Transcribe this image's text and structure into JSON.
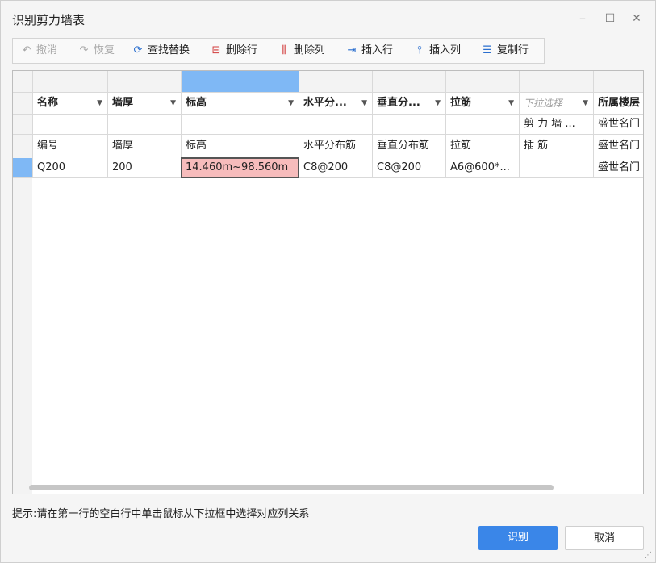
{
  "window": {
    "title": "识别剪力墙表",
    "controls": {
      "minimize": "–",
      "maximize": "☐",
      "close": "✕"
    }
  },
  "toolbar": {
    "undo": {
      "label": "撤消",
      "icon": "undo-icon",
      "glyph": "↶",
      "enabled": false
    },
    "redo": {
      "label": "恢复",
      "icon": "redo-icon",
      "glyph": "↷",
      "enabled": false
    },
    "find_replace": {
      "label": "查找替换",
      "icon": "find-replace-icon",
      "glyph": "⟳",
      "enabled": true
    },
    "delete_row": {
      "label": "删除行",
      "icon": "delete-row-icon",
      "glyph": "⊟",
      "enabled": true
    },
    "delete_col": {
      "label": "删除列",
      "icon": "delete-column-icon",
      "glyph": "⫼",
      "enabled": true
    },
    "insert_row": {
      "label": "插入行",
      "icon": "insert-row-icon",
      "glyph": "⇥",
      "enabled": true
    },
    "insert_col": {
      "label": "插入列",
      "icon": "insert-column-icon",
      "glyph": "⫯",
      "enabled": true
    },
    "copy_row": {
      "label": "复制行",
      "icon": "copy-row-icon",
      "glyph": "☰",
      "enabled": true
    }
  },
  "grid": {
    "header_row": [
      "名称",
      "墙厚",
      "标高",
      "水平分...",
      "垂直分...",
      "拉筋",
      "下拉选择",
      "所属楼层"
    ],
    "header_has_dropdown": [
      true,
      true,
      true,
      true,
      true,
      true,
      true,
      false
    ],
    "sub_row": [
      "",
      "",
      "",
      "",
      "",
      "",
      "剪 力 墙 ...",
      "盛世名门"
    ],
    "rows": [
      [
        "编号",
        "墙厚",
        "标高",
        "水平分布筋",
        "垂直分布筋",
        "拉筋",
        "插 筋",
        "盛世名门"
      ],
      [
        "Q200",
        "200",
        "14.460m~98.560m",
        "C8@200",
        "C8@200",
        "A6@600*...",
        "",
        "盛世名门"
      ]
    ]
  },
  "tip": "提示:请在第一行的空白行中单击鼠标从下拉框中选择对应列关系",
  "buttons": {
    "ok": "识别",
    "cancel": "取消"
  },
  "colors": {
    "accent": "#3a86e8",
    "selected_column": "#7fb8f5",
    "selected_cell": "#f7bcbc",
    "row_marker": "#7fb8f5"
  }
}
